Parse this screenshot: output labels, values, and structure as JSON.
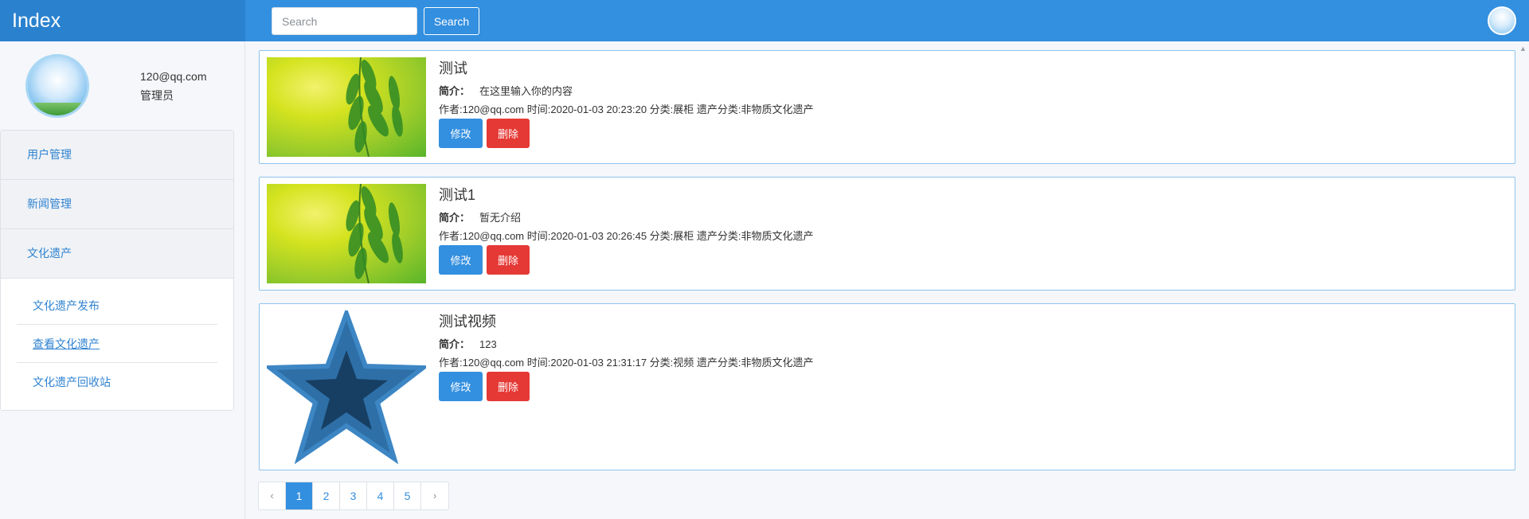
{
  "header": {
    "brand": "Index",
    "search_placeholder": "Search",
    "search_button": "Search"
  },
  "sidebar": {
    "email": "120@qq.com",
    "role": "管理员",
    "menu": [
      "用户管理",
      "新闻管理",
      "文化遗产"
    ],
    "submenu": [
      "文化遗产发布",
      "查看文化遗产",
      "文化遗产回收站"
    ]
  },
  "items": [
    {
      "title": "测试",
      "intro_label": "简介：",
      "intro": "在这里输入你的内容",
      "meta": "作者:120@qq.com 时间:2020-01-03 20:23:20 分类:展柜 遗产分类:非物质文化遗产",
      "thumb": "leaf-image",
      "edit": "修改",
      "delete": "删除"
    },
    {
      "title": "测试1",
      "intro_label": "简介：",
      "intro": "暂无介绍",
      "meta": "作者:120@qq.com 时间:2020-01-03 20:26:45 分类:展柜 遗产分类:非物质文化遗产",
      "thumb": "leaf-image",
      "edit": "修改",
      "delete": "删除"
    },
    {
      "title": "测试视频",
      "intro_label": "简介：",
      "intro": "123",
      "meta": "作者:120@qq.com 时间:2020-01-03 21:31:17 分类:视频 遗产分类:非物质文化遗产",
      "thumb": "star-image",
      "edit": "修改",
      "delete": "删除"
    }
  ],
  "pagination": {
    "prev": "‹",
    "pages": [
      "1",
      "2",
      "3",
      "4",
      "5"
    ],
    "next": "›",
    "current": "1"
  },
  "colors": {
    "primary": "#338fdf",
    "brand_bg": "#2a82cf",
    "danger": "#e53935",
    "card_border": "#8ec4ee"
  }
}
